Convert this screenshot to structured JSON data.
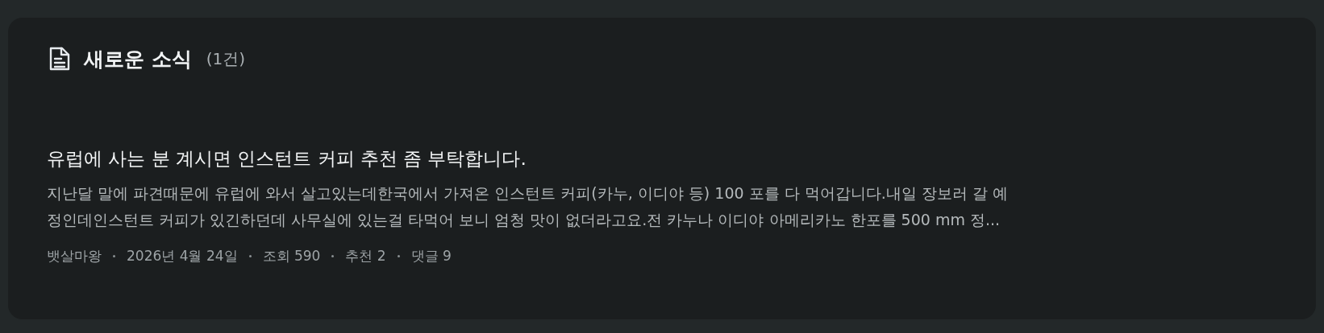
{
  "header": {
    "title": "새로운 소식",
    "count": "(1건)"
  },
  "posts": [
    {
      "title": "유럽에 사는 분 계시면 인스턴트 커피 추천 좀 부탁합니다.",
      "excerpt_lines": [
        "지난달 말에 파견때문에 유럽에 와서 살고있는데한국에서 가져온 인스턴트 커피(카누, 이디야 등) 100 포를 다 먹어갑니다.내일 장보러 갈 예",
        "정인데인스턴트 커피가 있긴하던데 사무실에 있는걸 타먹어 보니 엄청 맛이 없더라고요.전 카누나 이디야 아메리카노 한포를 500 mm 정..."
      ],
      "meta": [
        "뱃살마왕",
        "2026년 4월 24일",
        "조회 590",
        "추천 2",
        "댓글 9"
      ]
    }
  ]
}
